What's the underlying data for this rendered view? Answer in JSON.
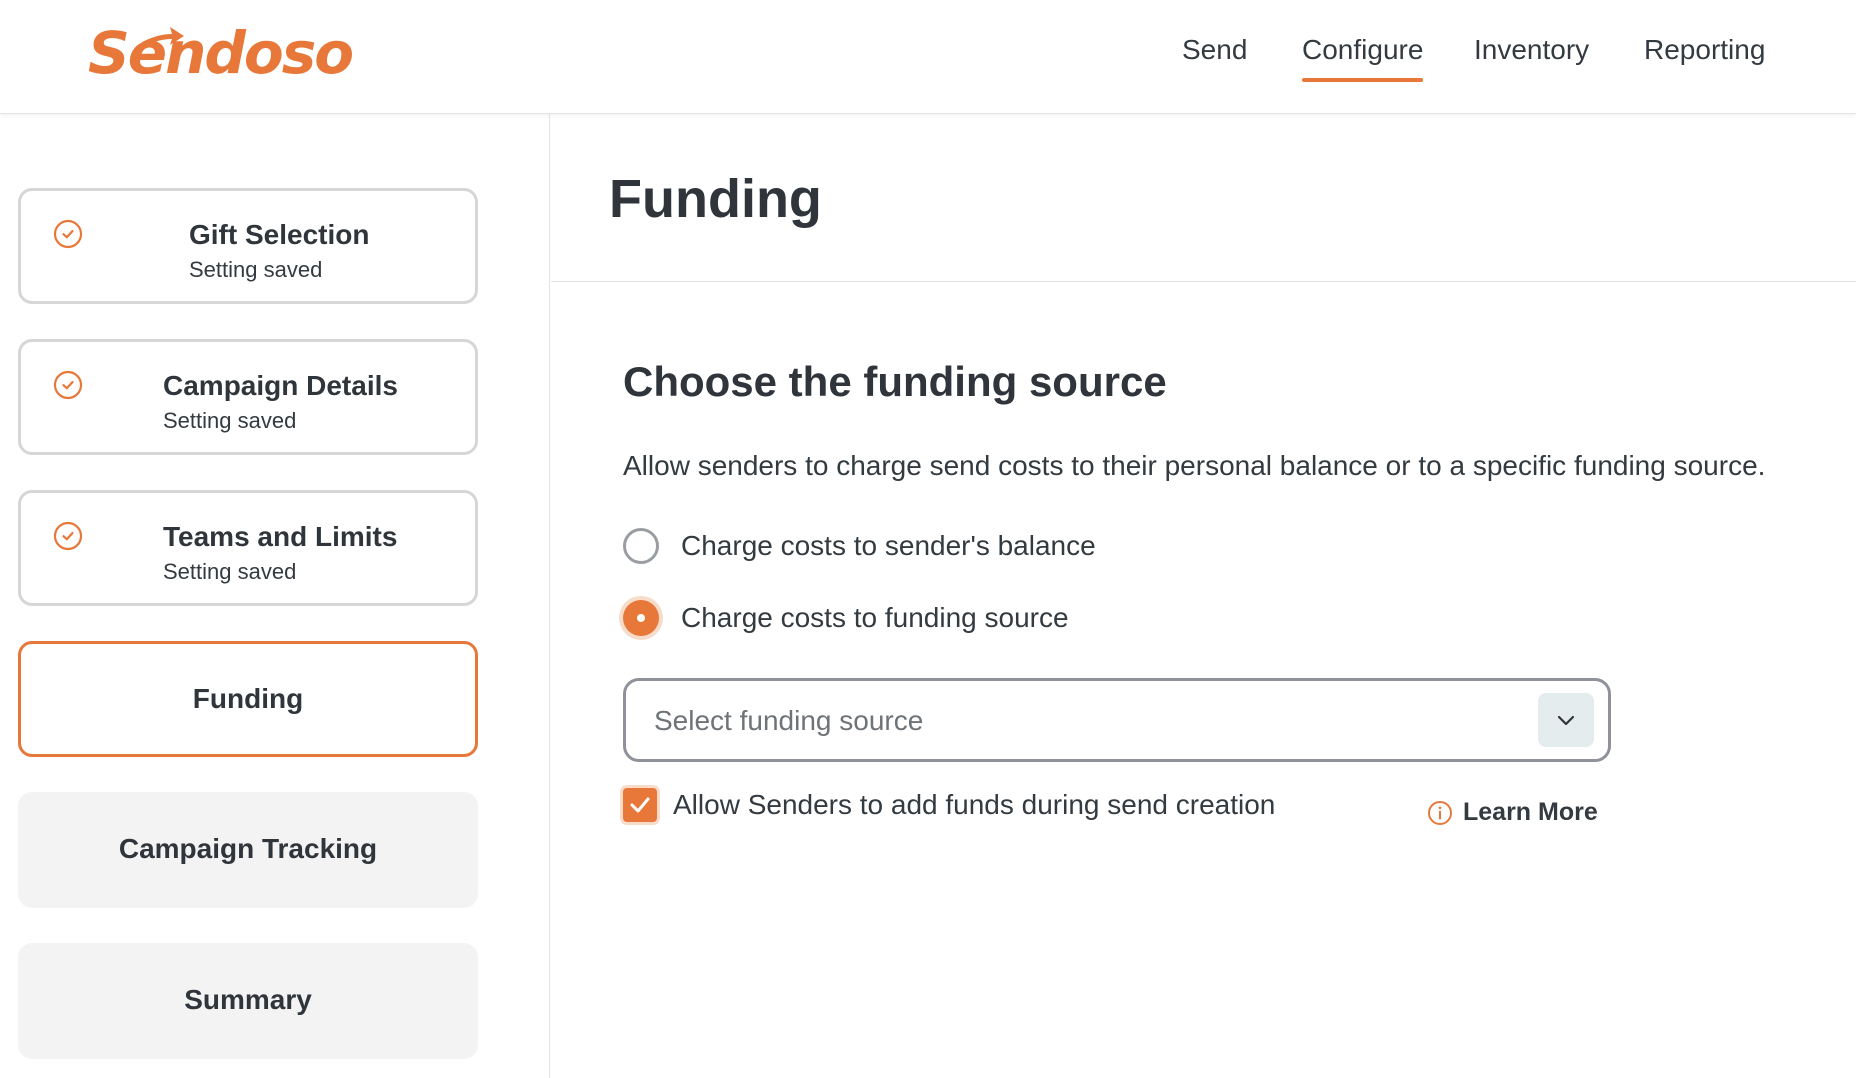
{
  "brand": {
    "name": "Sendoso",
    "accent_color": "#e8783a"
  },
  "nav": {
    "items": [
      {
        "label": "Send",
        "active": false
      },
      {
        "label": "Configure",
        "active": true
      },
      {
        "label": "Inventory",
        "active": false
      },
      {
        "label": "Reporting",
        "active": false
      }
    ]
  },
  "sidebar": {
    "steps": [
      {
        "title": "Gift Selection",
        "status": "Setting saved",
        "state": "saved",
        "icon": "check-circle-icon"
      },
      {
        "title": "Campaign Details",
        "status": "Setting saved",
        "state": "saved",
        "icon": "check-circle-icon"
      },
      {
        "title": "Teams and Limits",
        "status": "Setting saved",
        "state": "saved",
        "icon": "check-circle-icon"
      },
      {
        "title": "Funding",
        "state": "active"
      },
      {
        "title": "Campaign Tracking",
        "state": "pending"
      },
      {
        "title": "Summary",
        "state": "pending"
      }
    ]
  },
  "main": {
    "page_title": "Funding",
    "section_title": "Choose the funding source",
    "description": "Allow senders to charge send costs to their personal balance or to a specific funding source.",
    "options": [
      {
        "label": "Charge costs to sender's balance",
        "selected": false
      },
      {
        "label": "Charge costs to funding source",
        "selected": true
      }
    ],
    "funding_select": {
      "placeholder": "Select funding source",
      "icon": "chevron-down-icon"
    },
    "allow_add_funds": {
      "label": "Allow Senders to add funds during send creation",
      "checked": true
    },
    "learn_more": {
      "label": "Learn More",
      "icon": "info-icon"
    }
  }
}
